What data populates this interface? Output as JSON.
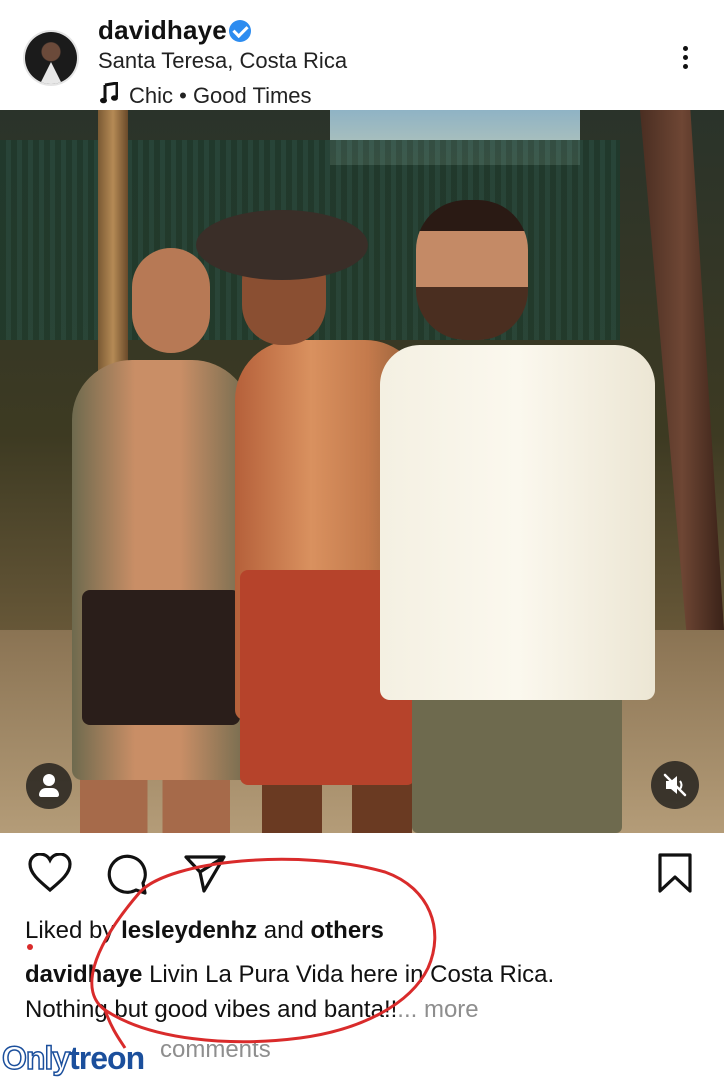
{
  "post": {
    "username": "davidhaye",
    "location": "Santa Teresa, Costa Rica",
    "music": "Chic • Good Times",
    "likes": {
      "prefix": "Liked by",
      "user": "lesleydenhz",
      "and": "and",
      "others": "others"
    },
    "caption": {
      "user": "davidhaye",
      "line1": "Livin La Pura Vida here in Costa Rica.",
      "line2": "Nothing but good vibes and banta!!",
      "more": "... more"
    },
    "comments_link": "View all comments",
    "comments_visible": "comments"
  },
  "icons": {
    "verified": "verified-badge-icon",
    "music": "music-note-icon",
    "more": "more-options-icon",
    "like": "heart-icon",
    "comment": "comment-icon",
    "share": "send-icon",
    "save": "bookmark-icon",
    "tags": "tagged-people-icon",
    "mute": "muted-speaker-icon"
  },
  "colors": {
    "verified": "#2d8cf0",
    "annotation": "#d92b2b",
    "watermark": "#1b4f9c"
  },
  "watermark": {
    "part1": "Only",
    "part2": "treon"
  }
}
